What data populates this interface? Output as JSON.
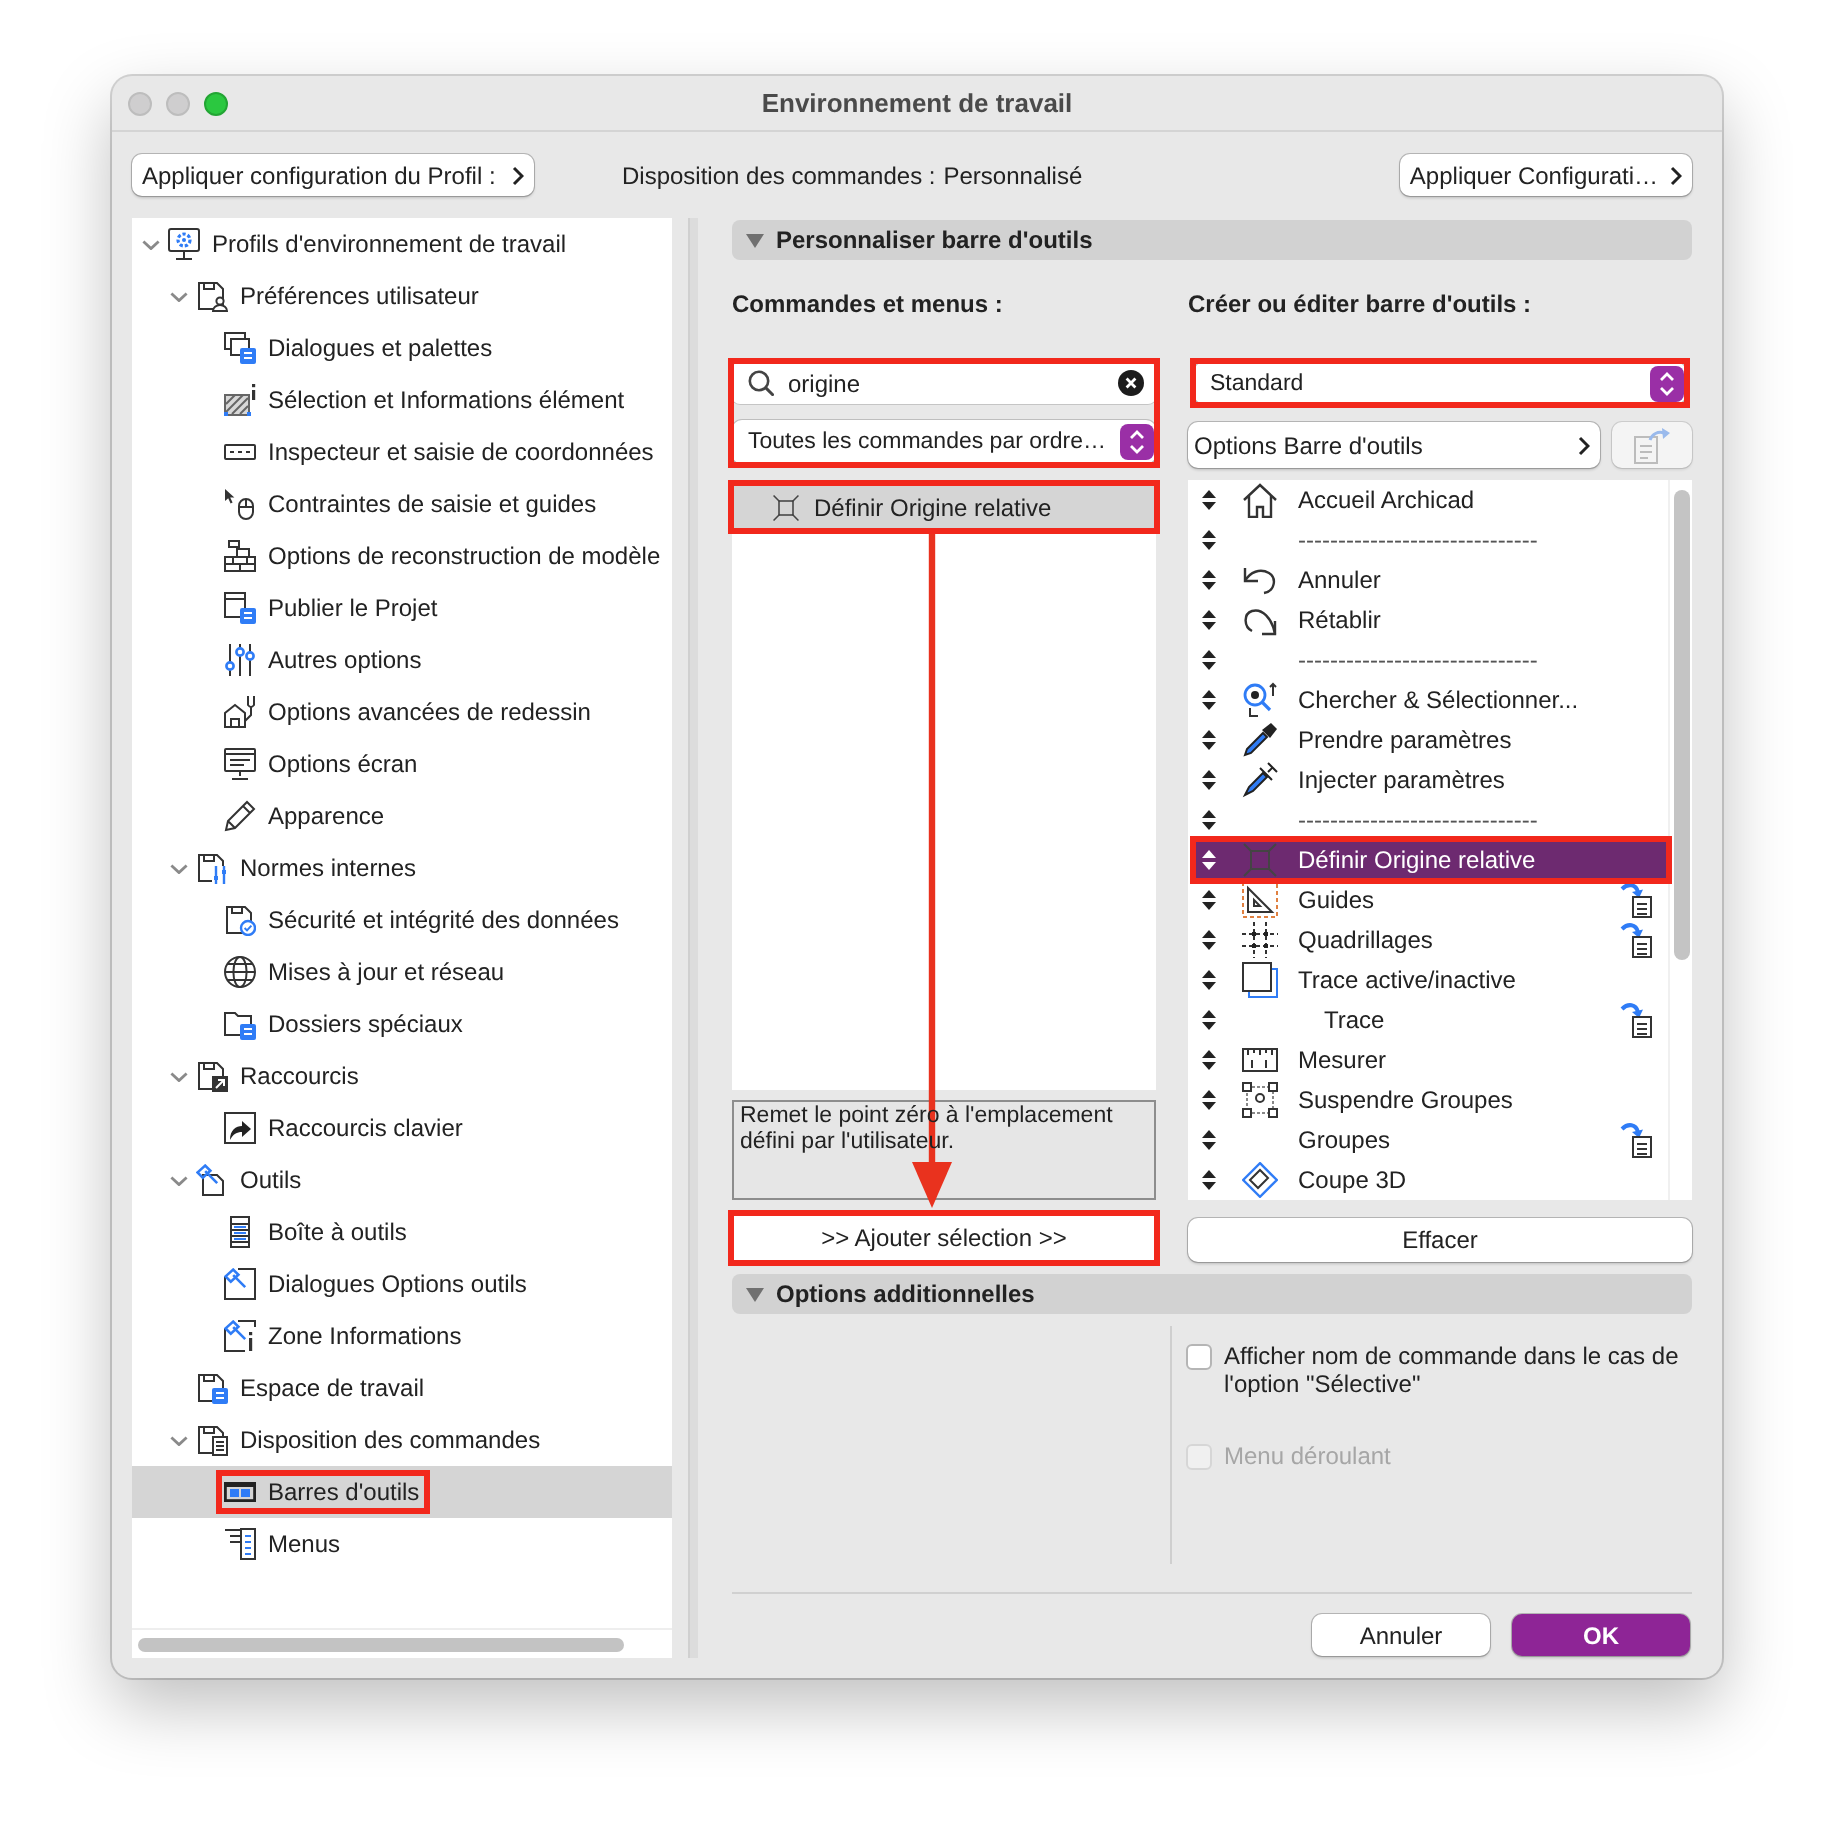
{
  "window": {
    "title": "Environnement de travail"
  },
  "top_bar": {
    "profile_button": "Appliquer configuration du Profil :",
    "layout_label": "Disposition des commandes :",
    "layout_value": "Personnalisé",
    "apply_button": "Appliquer Configurati…"
  },
  "sidebar": {
    "tree": [
      {
        "label": "Profils d'environnement de travail",
        "expanded": true,
        "selected": false,
        "highlighted": false,
        "children": [
          {
            "label": "Préférences utilisateur",
            "expanded": true,
            "selected": false,
            "highlighted": false,
            "children": [
              {
                "label": "Dialogues et palettes",
                "selected": false,
                "highlighted": false
              },
              {
                "label": "Sélection et Informations élément",
                "selected": false,
                "highlighted": false
              },
              {
                "label": "Inspecteur et saisie de coordonnées",
                "selected": false,
                "highlighted": false
              },
              {
                "label": "Contraintes de saisie et guides",
                "selected": false,
                "highlighted": false
              },
              {
                "label": "Options de reconstruction de modèle",
                "selected": false,
                "highlighted": false
              },
              {
                "label": "Publier le Projet",
                "selected": false,
                "highlighted": false
              },
              {
                "label": "Autres options",
                "selected": false,
                "highlighted": false
              },
              {
                "label": "Options avancées de redessin",
                "selected": false,
                "highlighted": false
              },
              {
                "label": "Options écran",
                "selected": false,
                "highlighted": false
              },
              {
                "label": "Apparence",
                "selected": false,
                "highlighted": false
              }
            ]
          },
          {
            "label": "Normes internes",
            "expanded": true,
            "selected": false,
            "highlighted": false,
            "children": [
              {
                "label": "Sécurité et intégrité des données",
                "selected": false,
                "highlighted": false
              },
              {
                "label": "Mises à jour et réseau",
                "selected": false,
                "highlighted": false
              },
              {
                "label": "Dossiers spéciaux",
                "selected": false,
                "highlighted": false
              }
            ]
          },
          {
            "label": "Raccourcis",
            "expanded": true,
            "selected": false,
            "highlighted": false,
            "children": [
              {
                "label": "Raccourcis clavier",
                "selected": false,
                "highlighted": false
              }
            ]
          },
          {
            "label": "Outils",
            "expanded": true,
            "selected": false,
            "highlighted": false,
            "children": [
              {
                "label": "Boîte à outils",
                "selected": false,
                "highlighted": false
              },
              {
                "label": "Dialogues Options outils",
                "selected": false,
                "highlighted": false
              },
              {
                "label": "Zone Informations",
                "selected": false,
                "highlighted": false
              }
            ]
          },
          {
            "label": "Espace de travail",
            "selected": false,
            "highlighted": false
          },
          {
            "label": "Disposition des commandes",
            "expanded": true,
            "selected": false,
            "highlighted": false,
            "children": [
              {
                "label": "Barres d'outils",
                "selected": true,
                "highlighted": true
              },
              {
                "label": "Menus",
                "selected": false,
                "highlighted": false
              }
            ]
          }
        ]
      }
    ]
  },
  "customize_section": {
    "title": "Personnaliser barre d'outils",
    "expanded": true,
    "commands": {
      "heading": "Commandes et menus :",
      "filters": {
        "highlighted": true,
        "search": {
          "value": "origine"
        },
        "category": {
          "value": "Toutes les commandes par ordre…"
        }
      },
      "items": [
        {
          "label": "Définir Origine relative",
          "selected": true,
          "highlighted": true
        }
      ],
      "description": "Remet le point zéro à l'emplacement défini par l'utilisateur.",
      "add_button": {
        "label": ">> Ajouter sélection >>",
        "highlighted": true
      },
      "arrow_to_add_button": true
    },
    "toolbar": {
      "heading": "Créer ou éditer barre d'outils :",
      "select": {
        "value": "Standard",
        "highlighted": true
      },
      "options_button": "Options Barre d'outils",
      "export_button": {
        "disabled": true
      },
      "items": [
        {
          "kind": "command",
          "label": "Accueil Archicad",
          "selected": false,
          "highlighted": false,
          "has_submenu": false
        },
        {
          "kind": "separator",
          "label": "------------------------------",
          "selected": false,
          "highlighted": false,
          "has_submenu": false
        },
        {
          "kind": "command",
          "label": "Annuler",
          "selected": false,
          "highlighted": false,
          "has_submenu": false
        },
        {
          "kind": "command",
          "label": "Rétablir",
          "selected": false,
          "highlighted": false,
          "has_submenu": false
        },
        {
          "kind": "separator",
          "label": "------------------------------",
          "selected": false,
          "highlighted": false,
          "has_submenu": false
        },
        {
          "kind": "command",
          "label": "Chercher & Sélectionner...",
          "selected": false,
          "highlighted": false,
          "has_submenu": false
        },
        {
          "kind": "command",
          "label": "Prendre paramètres",
          "selected": false,
          "highlighted": false,
          "has_submenu": false
        },
        {
          "kind": "command",
          "label": "Injecter paramètres",
          "selected": false,
          "highlighted": false,
          "has_submenu": false
        },
        {
          "kind": "separator",
          "label": "------------------------------",
          "selected": false,
          "highlighted": false,
          "has_submenu": false
        },
        {
          "kind": "command",
          "label": "Définir Origine relative",
          "selected": true,
          "highlighted": true,
          "has_submenu": false
        },
        {
          "kind": "command",
          "label": "Guides",
          "selected": false,
          "highlighted": false,
          "has_submenu": true
        },
        {
          "kind": "command",
          "label": "Quadrillages",
          "selected": false,
          "highlighted": false,
          "has_submenu": true
        },
        {
          "kind": "command",
          "label": "Trace active/inactive",
          "selected": false,
          "highlighted": false,
          "has_submenu": false
        },
        {
          "kind": "sub",
          "label": "Trace",
          "selected": false,
          "highlighted": false,
          "has_submenu": true
        },
        {
          "kind": "command",
          "label": "Mesurer",
          "selected": false,
          "highlighted": false,
          "has_submenu": false
        },
        {
          "kind": "command",
          "label": "Suspendre Groupes",
          "selected": false,
          "highlighted": false,
          "has_submenu": false
        },
        {
          "kind": "command",
          "label": "Groupes",
          "selected": false,
          "highlighted": false,
          "has_submenu": true
        },
        {
          "kind": "command",
          "label": "Coupe 3D",
          "selected": false,
          "highlighted": false,
          "has_submenu": false
        }
      ],
      "clear_button": "Effacer"
    }
  },
  "options_section": {
    "title": "Options additionnelles",
    "expanded": true,
    "checkboxes": [
      {
        "label": "Afficher nom de commande dans le cas de l'option \"Sélective\"",
        "checked": false,
        "disabled": false
      },
      {
        "label": "Menu déroulant",
        "checked": false,
        "disabled": true
      }
    ]
  },
  "buttons": [
    {
      "label": "Annuler",
      "default": false
    },
    {
      "label": "OK",
      "default": true
    }
  ]
}
